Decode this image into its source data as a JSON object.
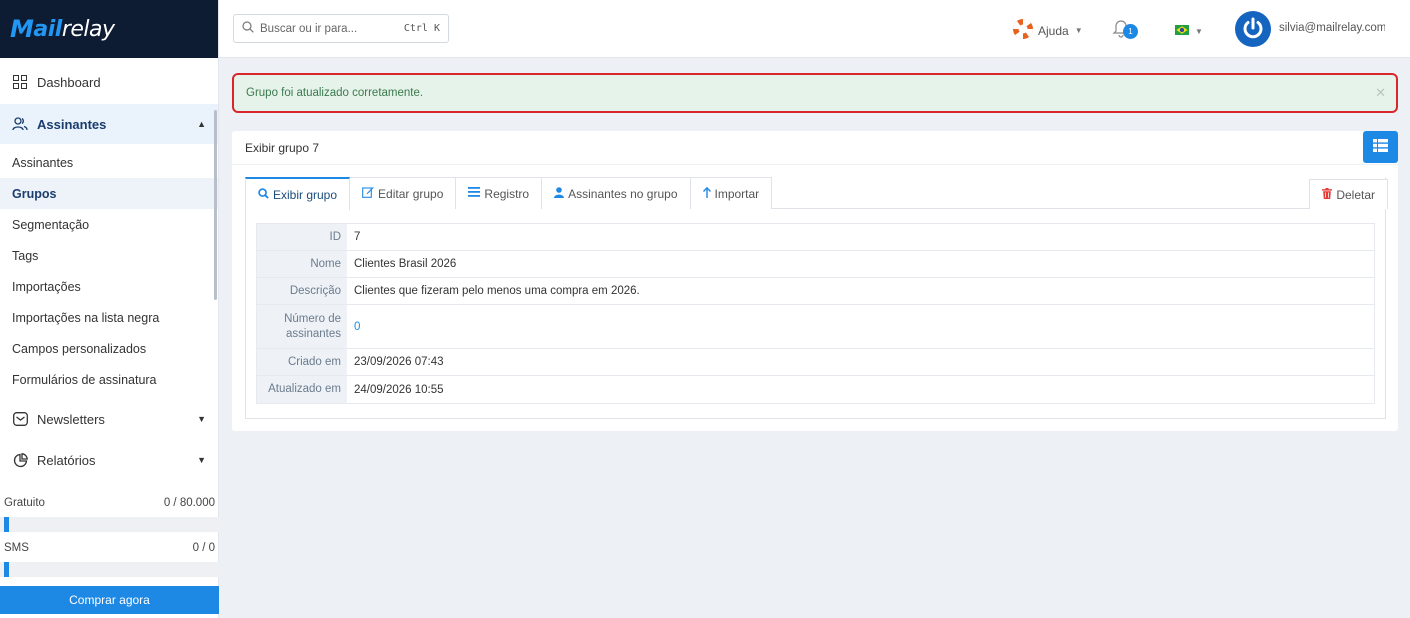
{
  "brand": {
    "logo_m": "M",
    "logo_ail": "ail",
    "logo_relay": "relay"
  },
  "sidebar": {
    "dashboard": "Dashboard",
    "subscribers_section": "Assinantes",
    "sub_items": [
      "Assinantes",
      "Grupos",
      "Segmentação",
      "Tags",
      "Importações",
      "Importações na lista negra",
      "Campos personalizados",
      "Formulários de assinatura"
    ],
    "newsletters": "Newsletters",
    "reports": "Relatórios",
    "usage": [
      {
        "label": "Gratuito",
        "value": "0 / 80.000",
        "fraction": 0.0
      },
      {
        "label": "SMS",
        "value": "0 / 0",
        "fraction": 0.0
      }
    ],
    "buy_button": "Comprar agora"
  },
  "topbar": {
    "search_placeholder": "Buscar ou ir para...",
    "search_shortcut": "Ctrl K",
    "help_label": "Ajuda",
    "notifications_count": "1",
    "user_email": "silvia@mailrelay.com"
  },
  "alert": {
    "message": "Grupo foi atualizado corretamente."
  },
  "panel": {
    "title": "Exibir grupo 7",
    "tabs": [
      "Exibir grupo",
      "Editar grupo",
      "Registro",
      "Assinantes no grupo",
      "Importar"
    ],
    "delete_label": "Deletar",
    "details": [
      {
        "key": "ID",
        "value": "7"
      },
      {
        "key": "Nome",
        "value": "Clientes Brasil 2026"
      },
      {
        "key": "Descrição",
        "value": "Clientes que fizeram pelo menos uma compra em 2026."
      },
      {
        "key": "Número de assinantes",
        "value": "0"
      },
      {
        "key": "Criado em",
        "value": "23/09/2026 07:43"
      },
      {
        "key": "Atualizado em",
        "value": "24/09/2026 10:55"
      }
    ]
  },
  "colors": {
    "accent": "#1e88e5",
    "sidebar_dark": "#0d1b33",
    "alert_border": "#d9262c",
    "alert_bg": "#e6f3ea"
  }
}
